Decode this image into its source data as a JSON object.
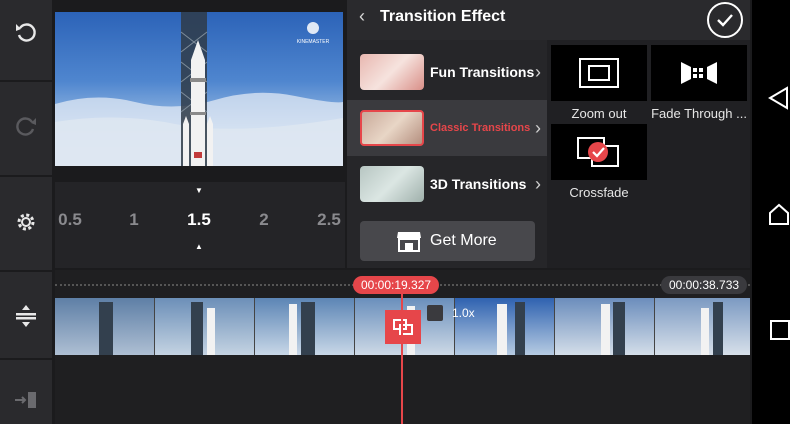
{
  "panel": {
    "title": "Transition Effect"
  },
  "categories": [
    {
      "label": "Fun Transitions",
      "selected": false
    },
    {
      "label": "Classic Transitions",
      "selected": true
    },
    {
      "label": "3D Transitions",
      "selected": false
    }
  ],
  "get_more_label": "Get More",
  "effects": [
    {
      "label": "Zoom out",
      "icon": "zoom-out-icon"
    },
    {
      "label": "Fade Through ...",
      "icon": "fade-through-icon"
    },
    {
      "label": "Crossfade",
      "icon": "crossfade-icon",
      "applied": true
    }
  ],
  "ruler": {
    "ticks": [
      "0.5",
      "1",
      "1.5",
      "2",
      "2.5"
    ],
    "active": "1.5"
  },
  "timeline": {
    "playhead_time": "00:00:19.327",
    "total_time": "00:00:38.733",
    "speed": "1.0x"
  },
  "preview": {
    "watermark": "KINEMASTER"
  },
  "colors": {
    "accent": "#e6464a",
    "panel": "#202023",
    "rail": "#2a2a2d"
  }
}
